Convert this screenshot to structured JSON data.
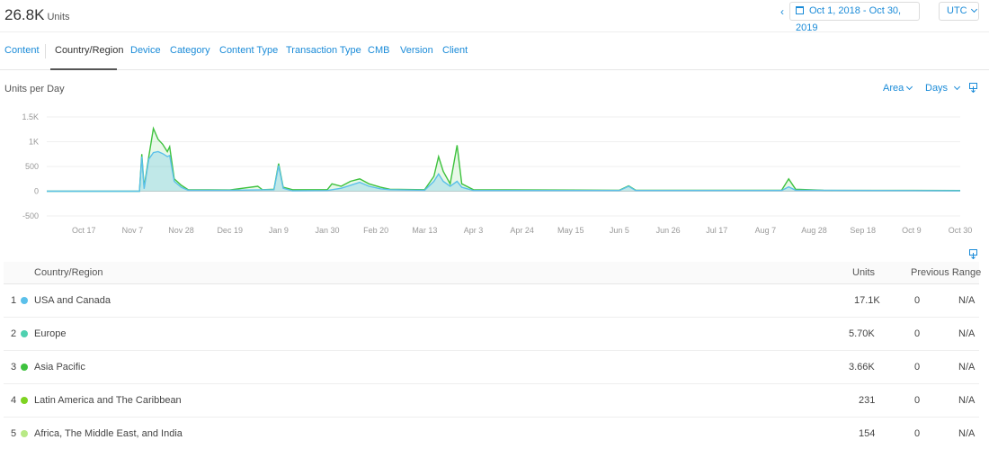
{
  "summary": {
    "total": "26.8K",
    "unit": "Units"
  },
  "header": {
    "prev_arrow": "‹",
    "date_range": "Oct 1, 2018 - Oct 30, 2019",
    "timezone": "UTC"
  },
  "tabs": [
    {
      "label": "Content"
    },
    {
      "label": "Country/Region"
    },
    {
      "label": "Device"
    },
    {
      "label": "Category"
    },
    {
      "label": "Content Type"
    },
    {
      "label": "Transaction Type"
    },
    {
      "label": "CMB"
    },
    {
      "label": "Version"
    },
    {
      "label": "Client"
    }
  ],
  "chart_controls": {
    "title": "Units per Day",
    "type_select": "Area",
    "interval_select": "Days"
  },
  "chart_data": {
    "type": "area",
    "ylabel": "Units per Day",
    "y_ticks": [
      "1.5K",
      "1K",
      "500",
      "0",
      "-500"
    ],
    "ylim": [
      -500,
      1500
    ],
    "x_ticks": [
      "Oct 17",
      "Nov 7",
      "Nov 28",
      "Dec 19",
      "Jan 9",
      "Jan 30",
      "Feb 20",
      "Mar 13",
      "Apr 3",
      "Apr 24",
      "May 15",
      "Jun 5",
      "Jun 26",
      "Jul 17",
      "Aug 7",
      "Aug 28",
      "Sep 18",
      "Oct 9",
      "Oct 30"
    ],
    "x_start": "2018-10-01",
    "grid": true,
    "series": [
      {
        "name": "USA and Canada",
        "color": "#5bc0ea",
        "points": [
          [
            "2018-10-01",
            0
          ],
          [
            "2018-11-10",
            0
          ],
          [
            "2018-11-11",
            700
          ],
          [
            "2018-11-12",
            50
          ],
          [
            "2018-11-14",
            650
          ],
          [
            "2018-11-16",
            780
          ],
          [
            "2018-11-18",
            800
          ],
          [
            "2018-11-20",
            760
          ],
          [
            "2018-11-22",
            700
          ],
          [
            "2018-11-23",
            720
          ],
          [
            "2018-11-25",
            200
          ],
          [
            "2018-11-28",
            80
          ],
          [
            "2018-12-01",
            20
          ],
          [
            "2018-12-19",
            20
          ],
          [
            "2019-01-07",
            30
          ],
          [
            "2019-01-09",
            520
          ],
          [
            "2019-01-11",
            60
          ],
          [
            "2019-01-15",
            10
          ],
          [
            "2019-01-30",
            15
          ],
          [
            "2019-02-05",
            60
          ],
          [
            "2019-02-09",
            120
          ],
          [
            "2019-02-13",
            180
          ],
          [
            "2019-02-17",
            100
          ],
          [
            "2019-02-22",
            50
          ],
          [
            "2019-02-26",
            30
          ],
          [
            "2019-03-13",
            20
          ],
          [
            "2019-03-17",
            200
          ],
          [
            "2019-03-19",
            350
          ],
          [
            "2019-03-21",
            200
          ],
          [
            "2019-03-24",
            100
          ],
          [
            "2019-03-27",
            200
          ],
          [
            "2019-03-29",
            80
          ],
          [
            "2019-04-03",
            15
          ],
          [
            "2019-06-05",
            15
          ],
          [
            "2019-06-09",
            100
          ],
          [
            "2019-06-12",
            15
          ],
          [
            "2019-08-14",
            15
          ],
          [
            "2019-08-17",
            90
          ],
          [
            "2019-08-20",
            20
          ],
          [
            "2019-10-30",
            10
          ]
        ]
      },
      {
        "name": "Asia Pacific",
        "color": "#3ec23e",
        "points": [
          [
            "2018-10-01",
            0
          ],
          [
            "2018-11-10",
            0
          ],
          [
            "2018-11-11",
            750
          ],
          [
            "2018-11-12",
            80
          ],
          [
            "2018-11-14",
            700
          ],
          [
            "2018-11-16",
            1270
          ],
          [
            "2018-11-18",
            1050
          ],
          [
            "2018-11-20",
            950
          ],
          [
            "2018-11-22",
            800
          ],
          [
            "2018-11-23",
            900
          ],
          [
            "2018-11-25",
            250
          ],
          [
            "2018-11-28",
            120
          ],
          [
            "2018-12-01",
            30
          ],
          [
            "2018-12-19",
            25
          ],
          [
            "2018-12-31",
            100
          ],
          [
            "2019-01-02",
            30
          ],
          [
            "2019-01-07",
            40
          ],
          [
            "2019-01-09",
            560
          ],
          [
            "2019-01-11",
            80
          ],
          [
            "2019-01-15",
            30
          ],
          [
            "2019-01-30",
            30
          ],
          [
            "2019-02-01",
            150
          ],
          [
            "2019-02-05",
            100
          ],
          [
            "2019-02-09",
            200
          ],
          [
            "2019-02-13",
            250
          ],
          [
            "2019-02-17",
            150
          ],
          [
            "2019-02-22",
            80
          ],
          [
            "2019-02-26",
            40
          ],
          [
            "2019-03-13",
            30
          ],
          [
            "2019-03-17",
            300
          ],
          [
            "2019-03-19",
            700
          ],
          [
            "2019-03-21",
            400
          ],
          [
            "2019-03-24",
            150
          ],
          [
            "2019-03-27",
            930
          ],
          [
            "2019-03-29",
            150
          ],
          [
            "2019-04-03",
            30
          ],
          [
            "2019-06-05",
            20
          ],
          [
            "2019-06-09",
            110
          ],
          [
            "2019-06-12",
            20
          ],
          [
            "2019-08-14",
            20
          ],
          [
            "2019-08-17",
            250
          ],
          [
            "2019-08-20",
            40
          ],
          [
            "2019-09-01",
            20
          ],
          [
            "2019-10-30",
            15
          ]
        ]
      }
    ]
  },
  "table": {
    "columns": {
      "name": "Country/Region",
      "units": "Units",
      "previous": "Previous Range"
    },
    "rows": [
      {
        "rank": "1",
        "name": "USA and Canada",
        "units": "17.1K",
        "prev": "0",
        "change": "N/A",
        "color": "#5bc0ea"
      },
      {
        "rank": "2",
        "name": "Europe",
        "units": "5.70K",
        "prev": "0",
        "change": "N/A",
        "color": "#4fd1b0"
      },
      {
        "rank": "3",
        "name": "Asia Pacific",
        "units": "3.66K",
        "prev": "0",
        "change": "N/A",
        "color": "#3ec23e"
      },
      {
        "rank": "4",
        "name": "Latin America and The Caribbean",
        "units": "231",
        "prev": "0",
        "change": "N/A",
        "color": "#7ed321"
      },
      {
        "rank": "5",
        "name": "Africa, The Middle East, and India",
        "units": "154",
        "prev": "0",
        "change": "N/A",
        "color": "#b8e986"
      }
    ]
  }
}
